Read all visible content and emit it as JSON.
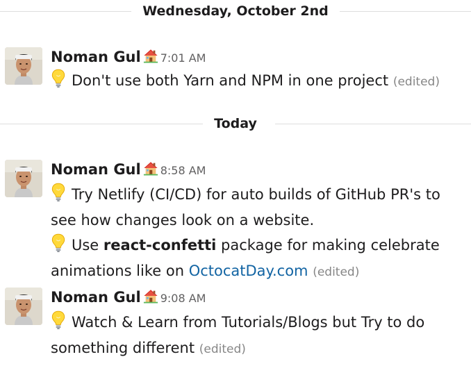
{
  "dividers": {
    "first": "Wednesday, October 2nd",
    "second": "Today"
  },
  "messages": [
    {
      "author": "Noman Gul",
      "status_emoji": "house-icon",
      "time": "7:01 AM",
      "lines": [
        {
          "icon": "lightbulb-icon",
          "text": "Don't use both Yarn and NPM in one project",
          "edited": "(edited)"
        }
      ]
    },
    {
      "author": "Noman Gul",
      "status_emoji": "house-icon",
      "time": "8:58 AM",
      "lines": [
        {
          "icon": "lightbulb-icon",
          "text": "Try Netlify (CI/CD) for auto builds of GitHub PR's to see how changes look on a website."
        },
        {
          "icon": "lightbulb-icon",
          "prefix": "Use ",
          "bold": "react-confetti",
          "middle": " package for making celebrate animations like on ",
          "link": "OctocatDay.com",
          "edited": "(edited)"
        }
      ]
    },
    {
      "author": "Noman Gul",
      "status_emoji": "house-icon",
      "time": "9:08 AM",
      "lines": [
        {
          "icon": "lightbulb-icon",
          "text": "Watch & Learn from Tutorials/Blogs but Try to do something different",
          "edited": "(edited)"
        }
      ]
    }
  ],
  "colors": {
    "link": "#1264a3",
    "timestamp": "#616061",
    "edited": "#868686",
    "divider_line": "#dddddd"
  }
}
